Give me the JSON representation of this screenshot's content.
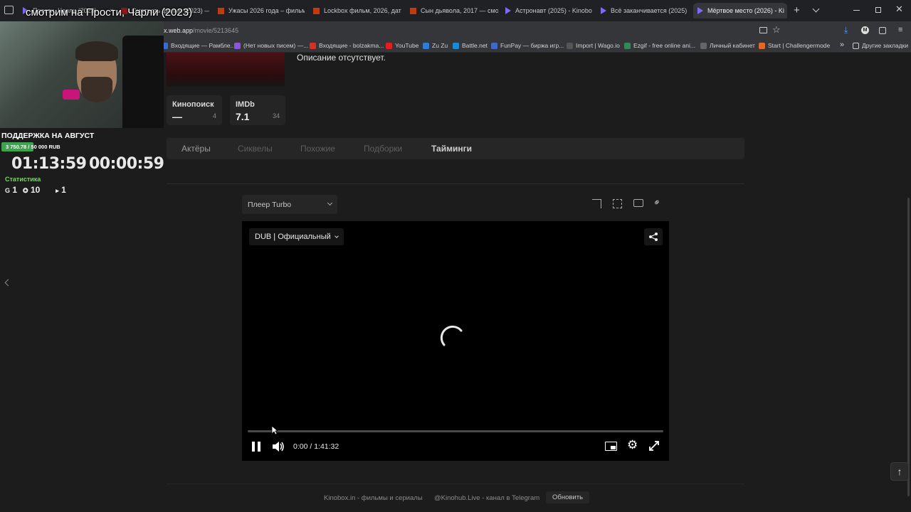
{
  "browser": {
    "tabs": [
      {
        "label": "Прости, Чарли (2023)",
        "close": "×"
      },
      {
        "label": "Смотреть фильм (2023) — Kin",
        "close": "×"
      },
      {
        "label": "Ужасы 2026 года – фильмы",
        "close": "×"
      },
      {
        "label": "Lockbox фильм, 2026, дата",
        "close": "×"
      },
      {
        "label": "Сын дьявола, 2017 — смот",
        "close": "×"
      },
      {
        "label": "Астронавт (2025) - Kinobo",
        "close": "×"
      },
      {
        "label": "Всё заканчивается (2025)",
        "close": "×"
      },
      {
        "label": "Мёртвое место (2026) - Ki",
        "close": "×"
      }
    ],
    "new_tab": "+",
    "address_host": "x.web.app",
    "address_path": "/movie/5213645",
    "bookmarks": [
      "Входящие — Рамбле...",
      "(Нет новых писем) —...",
      "Входящие - bolzakma...",
      "YouTube",
      "Zu Zu",
      "Battle.net",
      "FunPay — биржа игр...",
      "Import | Wago.io",
      "Ezgif - free online ani...",
      "Личный кабинет",
      "Start | Challengermode"
    ],
    "bookmarks_more": "»",
    "other_bookmarks": "Другие закладки"
  },
  "stream_overlay": {
    "title": "смотрим на Прости, Чарли (2023)",
    "support_title": "ПОДДЕРЖКА НА АВГУСТ",
    "support_progress": "3 750.78 / 50 000 RUB",
    "support_fraction": 0.075,
    "timer_total": "01:13:59",
    "timer_current": "00:00:59",
    "stats_label": "Статистика",
    "stats": [
      {
        "letter": "G",
        "value": "1"
      },
      {
        "letter": "✪",
        "value": "10"
      },
      {
        "letter": "▸",
        "value": "1"
      }
    ]
  },
  "movie": {
    "description": "Описание отсутствует.",
    "ratings": [
      {
        "name": "Кинопоиск",
        "value": "—",
        "count": "4"
      },
      {
        "name": "IMDb",
        "value": "7.1",
        "count": "34"
      }
    ],
    "tabs": [
      {
        "label": "Актёры"
      },
      {
        "label": "Сиквелы"
      },
      {
        "label": "Похожие"
      },
      {
        "label": "Подборки"
      },
      {
        "label": "Тайминги"
      }
    ]
  },
  "player": {
    "select_label": "Плеер Turbo",
    "dub_label": "DUB | Официальный",
    "time_current": "0:00",
    "time_separator": "/",
    "time_total": "1:41:32",
    "progress_fraction": 0.0
  },
  "footer": {
    "site_link": "Kinobox.in - фильмы и сериалы",
    "telegram_link": "@Kinohub.Live - канал в Telegram",
    "refresh_label": "Обновить"
  },
  "colors": {
    "background": "#1c1c1c",
    "panel": "#262626",
    "accent_green": "#3fa34d",
    "video_bg": "#000000"
  }
}
